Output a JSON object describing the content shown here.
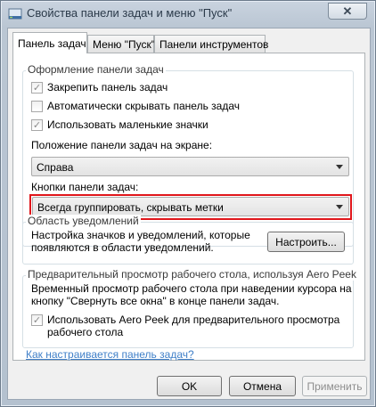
{
  "window": {
    "title": "Свойства панели задач и меню \"Пуск\"",
    "close_label": "✕"
  },
  "tabs": [
    {
      "label": "Панель задач",
      "active": true
    },
    {
      "label": "Меню \"Пуск\"",
      "active": false
    },
    {
      "label": "Панели инструментов",
      "active": false
    }
  ],
  "appearance": {
    "title": "Оформление панели задач",
    "lock_taskbar": {
      "label": "Закрепить панель задач",
      "checked": true
    },
    "auto_hide": {
      "label": "Автоматически скрывать панель задач",
      "checked": false
    },
    "small_icons": {
      "label": "Использовать маленькие значки",
      "checked": true
    },
    "position_label": "Положение панели задач на экране:",
    "position_value": "Справа",
    "buttons_label": "Кнопки панели задач:",
    "buttons_value": "Всегда группировать, скрывать метки"
  },
  "notifications": {
    "title": "Область уведомлений",
    "description_line1": "Настройка значков и уведомлений, которые",
    "description_line2": "появляются в области уведомлений.",
    "customize_button": "Настроить..."
  },
  "aero_peek": {
    "title": "Предварительный просмотр рабочего стола, используя Aero Peek",
    "description_line1": "Временный просмотр рабочего стола при наведении курсора на",
    "description_line2": "кнопку \"Свернуть все окна\" в конце панели задач.",
    "use_peek": {
      "label_line1": "Использовать Aero Peek для предварительного просмотра",
      "label_line2": "рабочего стола",
      "checked": true
    }
  },
  "help_link": "Как настраивается панель задач?",
  "footer": {
    "ok": "OK",
    "cancel": "Отмена",
    "apply": "Применить"
  }
}
